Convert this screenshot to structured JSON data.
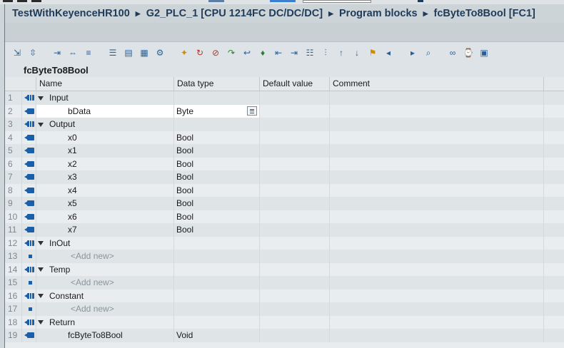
{
  "breadcrumb": [
    "TestWithKeyenceHR100",
    "G2_PLC_1 [CPU 1214FC DC/DC/DC]",
    "Program blocks",
    "fcByteTo8Bool [FC1]"
  ],
  "breadcrumb_separator": "▶",
  "block_title": "fcByteTo8Bool",
  "columns": {
    "name": "Name",
    "data_type": "Data type",
    "default_value": "Default value",
    "comment": "Comment"
  },
  "toolbar_icons": [
    "insert-row-icon",
    "add-row-icon",
    "expand-icon",
    "expand-all-icon",
    "collapse-icon",
    "properties-icon",
    "list-icon",
    "monitor-icon",
    "settings-icon",
    "star-icon",
    "call-icon",
    "stop-icon",
    "jump-icon",
    "return-icon",
    "network-icon",
    "indent-icon",
    "outdent-icon",
    "align-icon",
    "split-icon",
    "move-up-icon",
    "move-down-icon",
    "bookmark-icon",
    "prev-bookmark-icon",
    "next-bookmark-icon",
    "search-icon",
    "glasses-icon",
    "watch-icon",
    "db-icon"
  ],
  "rows": [
    {
      "num": "1",
      "kind": "section",
      "name": "Input",
      "type": ""
    },
    {
      "num": "2",
      "kind": "param",
      "name": "bData",
      "type": "Byte",
      "selected": true
    },
    {
      "num": "3",
      "kind": "section",
      "name": "Output",
      "type": ""
    },
    {
      "num": "4",
      "kind": "param",
      "name": "x0",
      "type": "Bool"
    },
    {
      "num": "5",
      "kind": "param",
      "name": "x1",
      "type": "Bool"
    },
    {
      "num": "6",
      "kind": "param",
      "name": "x2",
      "type": "Bool"
    },
    {
      "num": "7",
      "kind": "param",
      "name": "x3",
      "type": "Bool"
    },
    {
      "num": "8",
      "kind": "param",
      "name": "x4",
      "type": "Bool"
    },
    {
      "num": "9",
      "kind": "param",
      "name": "x5",
      "type": "Bool"
    },
    {
      "num": "10",
      "kind": "param",
      "name": "x6",
      "type": "Bool"
    },
    {
      "num": "11",
      "kind": "param",
      "name": "x7",
      "type": "Bool"
    },
    {
      "num": "12",
      "kind": "section",
      "name": "InOut",
      "type": ""
    },
    {
      "num": "13",
      "kind": "add",
      "name": "<Add new>",
      "type": ""
    },
    {
      "num": "14",
      "kind": "section",
      "name": "Temp",
      "type": ""
    },
    {
      "num": "15",
      "kind": "add",
      "name": "<Add new>",
      "type": ""
    },
    {
      "num": "16",
      "kind": "section",
      "name": "Constant",
      "type": ""
    },
    {
      "num": "17",
      "kind": "add",
      "name": "<Add new>",
      "type": ""
    },
    {
      "num": "18",
      "kind": "section",
      "name": "Return",
      "type": ""
    },
    {
      "num": "19",
      "kind": "param",
      "name": "fcByteTo8Bool",
      "type": "Void"
    }
  ],
  "colors": {
    "accent_blue": "#1a5fa8",
    "title_text": "#1f3b5a"
  }
}
